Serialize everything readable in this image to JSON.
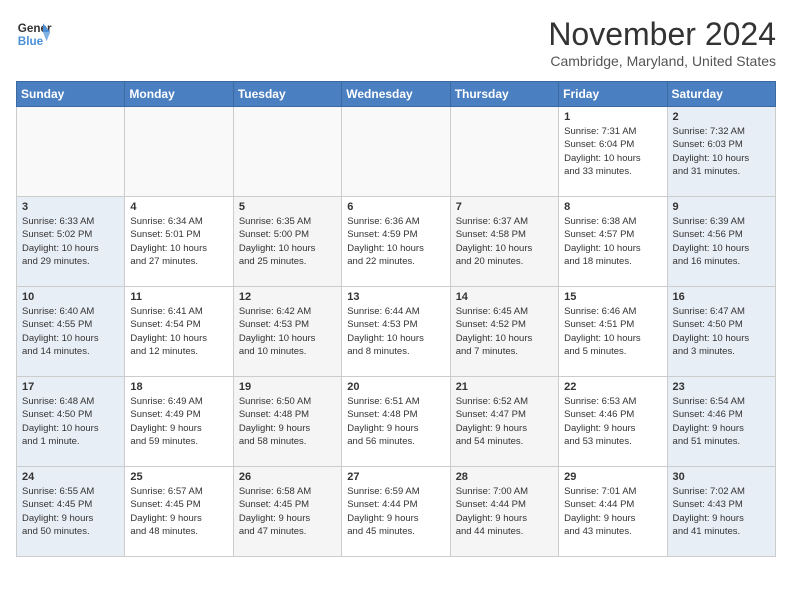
{
  "header": {
    "logo_line1": "General",
    "logo_line2": "Blue",
    "month": "November 2024",
    "location": "Cambridge, Maryland, United States"
  },
  "weekdays": [
    "Sunday",
    "Monday",
    "Tuesday",
    "Wednesday",
    "Thursday",
    "Friday",
    "Saturday"
  ],
  "weeks": [
    [
      {
        "day": "",
        "info": ""
      },
      {
        "day": "",
        "info": ""
      },
      {
        "day": "",
        "info": ""
      },
      {
        "day": "",
        "info": ""
      },
      {
        "day": "",
        "info": ""
      },
      {
        "day": "1",
        "info": "Sunrise: 7:31 AM\nSunset: 6:04 PM\nDaylight: 10 hours\nand 33 minutes."
      },
      {
        "day": "2",
        "info": "Sunrise: 7:32 AM\nSunset: 6:03 PM\nDaylight: 10 hours\nand 31 minutes."
      }
    ],
    [
      {
        "day": "3",
        "info": "Sunrise: 6:33 AM\nSunset: 5:02 PM\nDaylight: 10 hours\nand 29 minutes."
      },
      {
        "day": "4",
        "info": "Sunrise: 6:34 AM\nSunset: 5:01 PM\nDaylight: 10 hours\nand 27 minutes."
      },
      {
        "day": "5",
        "info": "Sunrise: 6:35 AM\nSunset: 5:00 PM\nDaylight: 10 hours\nand 25 minutes."
      },
      {
        "day": "6",
        "info": "Sunrise: 6:36 AM\nSunset: 4:59 PM\nDaylight: 10 hours\nand 22 minutes."
      },
      {
        "day": "7",
        "info": "Sunrise: 6:37 AM\nSunset: 4:58 PM\nDaylight: 10 hours\nand 20 minutes."
      },
      {
        "day": "8",
        "info": "Sunrise: 6:38 AM\nSunset: 4:57 PM\nDaylight: 10 hours\nand 18 minutes."
      },
      {
        "day": "9",
        "info": "Sunrise: 6:39 AM\nSunset: 4:56 PM\nDaylight: 10 hours\nand 16 minutes."
      }
    ],
    [
      {
        "day": "10",
        "info": "Sunrise: 6:40 AM\nSunset: 4:55 PM\nDaylight: 10 hours\nand 14 minutes."
      },
      {
        "day": "11",
        "info": "Sunrise: 6:41 AM\nSunset: 4:54 PM\nDaylight: 10 hours\nand 12 minutes."
      },
      {
        "day": "12",
        "info": "Sunrise: 6:42 AM\nSunset: 4:53 PM\nDaylight: 10 hours\nand 10 minutes."
      },
      {
        "day": "13",
        "info": "Sunrise: 6:44 AM\nSunset: 4:53 PM\nDaylight: 10 hours\nand 8 minutes."
      },
      {
        "day": "14",
        "info": "Sunrise: 6:45 AM\nSunset: 4:52 PM\nDaylight: 10 hours\nand 7 minutes."
      },
      {
        "day": "15",
        "info": "Sunrise: 6:46 AM\nSunset: 4:51 PM\nDaylight: 10 hours\nand 5 minutes."
      },
      {
        "day": "16",
        "info": "Sunrise: 6:47 AM\nSunset: 4:50 PM\nDaylight: 10 hours\nand 3 minutes."
      }
    ],
    [
      {
        "day": "17",
        "info": "Sunrise: 6:48 AM\nSunset: 4:50 PM\nDaylight: 10 hours\nand 1 minute."
      },
      {
        "day": "18",
        "info": "Sunrise: 6:49 AM\nSunset: 4:49 PM\nDaylight: 9 hours\nand 59 minutes."
      },
      {
        "day": "19",
        "info": "Sunrise: 6:50 AM\nSunset: 4:48 PM\nDaylight: 9 hours\nand 58 minutes."
      },
      {
        "day": "20",
        "info": "Sunrise: 6:51 AM\nSunset: 4:48 PM\nDaylight: 9 hours\nand 56 minutes."
      },
      {
        "day": "21",
        "info": "Sunrise: 6:52 AM\nSunset: 4:47 PM\nDaylight: 9 hours\nand 54 minutes."
      },
      {
        "day": "22",
        "info": "Sunrise: 6:53 AM\nSunset: 4:46 PM\nDaylight: 9 hours\nand 53 minutes."
      },
      {
        "day": "23",
        "info": "Sunrise: 6:54 AM\nSunset: 4:46 PM\nDaylight: 9 hours\nand 51 minutes."
      }
    ],
    [
      {
        "day": "24",
        "info": "Sunrise: 6:55 AM\nSunset: 4:45 PM\nDaylight: 9 hours\nand 50 minutes."
      },
      {
        "day": "25",
        "info": "Sunrise: 6:57 AM\nSunset: 4:45 PM\nDaylight: 9 hours\nand 48 minutes."
      },
      {
        "day": "26",
        "info": "Sunrise: 6:58 AM\nSunset: 4:45 PM\nDaylight: 9 hours\nand 47 minutes."
      },
      {
        "day": "27",
        "info": "Sunrise: 6:59 AM\nSunset: 4:44 PM\nDaylight: 9 hours\nand 45 minutes."
      },
      {
        "day": "28",
        "info": "Sunrise: 7:00 AM\nSunset: 4:44 PM\nDaylight: 9 hours\nand 44 minutes."
      },
      {
        "day": "29",
        "info": "Sunrise: 7:01 AM\nSunset: 4:44 PM\nDaylight: 9 hours\nand 43 minutes."
      },
      {
        "day": "30",
        "info": "Sunrise: 7:02 AM\nSunset: 4:43 PM\nDaylight: 9 hours\nand 41 minutes."
      }
    ]
  ]
}
